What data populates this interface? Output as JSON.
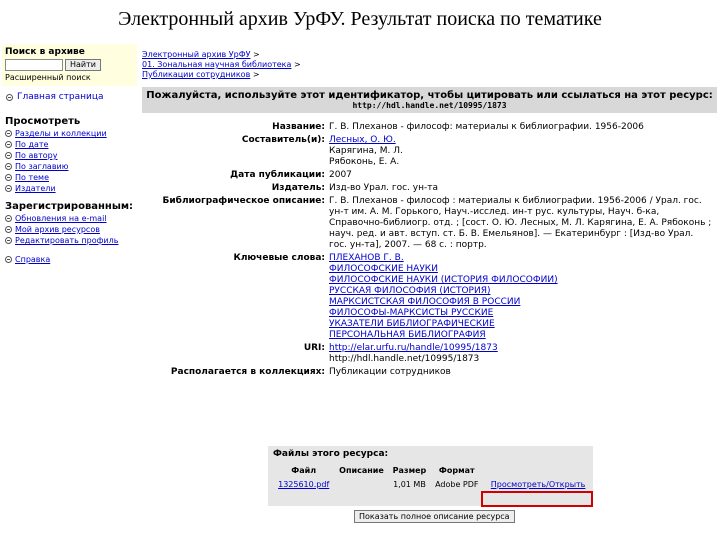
{
  "slide_title": "Электронный архив УрФУ. Результат поиска по тематике",
  "sidebar": {
    "search_title": "Поиск в архиве",
    "search_input_value": "",
    "search_button": "Найти",
    "advanced_search": "Расширенный поиск",
    "home": "Главная страница",
    "browse_title": "Просмотреть",
    "browse_items": [
      {
        "label": "Разделы и коллекции"
      },
      {
        "label": "По дате"
      },
      {
        "label": "По автору"
      },
      {
        "label": "По заглавию"
      },
      {
        "label": "По теме"
      },
      {
        "label": "Издатели"
      }
    ],
    "registered_title": "Зарегистрированным:",
    "registered_items": [
      {
        "label": "Обновления на e-mail"
      },
      {
        "label": "Мой архив ресурсов"
      },
      {
        "label": "Редактировать профиль"
      }
    ],
    "help": "Справка"
  },
  "breadcrumb": [
    {
      "label": "Электронный архив УрФУ",
      "sep": ">"
    },
    {
      "label": "01. Зональная научная библиотека",
      "sep": ">"
    },
    {
      "label": "Публикации сотрудников",
      "sep": ">"
    }
  ],
  "citation": {
    "text": "Пожалуйста, используйте этот идентификатор, чтобы цитировать или ссылаться на этот ресурс:",
    "url": "http://hdl.handle.net/10995/1873"
  },
  "meta": {
    "title_label": "Название:",
    "title_value": "Г. В. Плеханов - философ: материалы к библиографии. 1956-2006",
    "compiler_label": "Составитель(и):",
    "compilers": [
      "Лесных, О. Ю.",
      "Карягина, М. Л.",
      "Рябоконь, Е. А."
    ],
    "date_label": "Дата публикации:",
    "date_value": "2007",
    "publisher_label": "Издатель:",
    "publisher_value": "Изд-во Урал. гос. ун-та",
    "biblio_label": "Библиографическое описание:",
    "biblio_value": "Г. В. Плеханов - философ : материалы к библиографии. 1956-2006 / Урал. гос. ун-т им. А. М. Горького, Науч.-исслед. ин-т рус. культуры, Науч. б-ка, Справочно-библиогр. отд. ; [сост. О. Ю. Лесных, М. Л. Карягина, Е. А. Рябоконь ; науч. ред. и авт. вступ. ст. Б. В. Емельянов]. — Екатеринбург : [Изд-во Урал. гос. ун-та], 2007. — 68 с. : портр.",
    "keywords_label": "Ключевые слова:",
    "keywords": [
      "ПЛЕХАНОВ Г. В.",
      "ФИЛОСОФСКИЕ НАУКИ",
      "ФИЛОСОФСКИЕ НАУКИ (ИСТОРИЯ ФИЛОСОФИИ)",
      "РУССКАЯ ФИЛОСОФИЯ (ИСТОРИЯ)",
      "МАРКСИСТСКАЯ ФИЛОСОФИЯ В РОССИИ",
      "ФИЛОСОФЫ-МАРКСИСТЫ РУССКИЕ",
      "УКАЗАТЕЛИ БИБЛИОГРАФИЧЕСКИЕ",
      "ПЕРСОНАЛЬНАЯ БИБЛИОГРАФИЯ"
    ],
    "uri_label": "URI:",
    "uri_values": [
      "http://elar.urfu.ru/handle/10995/1873",
      "http://hdl.handle.net/10995/1873"
    ],
    "collection_label": "Располагается в коллекциях:",
    "collection_value": "Публикации сотрудников"
  },
  "files": {
    "title": "Файлы этого ресурса:",
    "headers": [
      "Файл",
      "Описание",
      "Размер",
      "Формат"
    ],
    "row": {
      "file": "1325610.pdf",
      "description": "",
      "size": "1,01 MB",
      "format": "Adobe PDF",
      "action": "Просмотреть/Открыть"
    },
    "full_record_button": "Показать полное описание ресурса"
  },
  "colors": {
    "link": "#0000cc",
    "highlight_border": "#d00000",
    "search_bg": "#ffffe0",
    "cite_bg": "#d8d8d8"
  }
}
